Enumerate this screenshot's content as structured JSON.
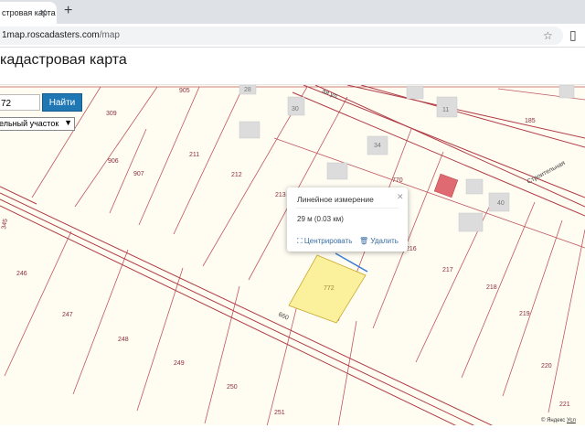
{
  "browser": {
    "tab_title": "стровая карта",
    "tab_close": "✕",
    "new_tab": "+",
    "url_host": "1map.roscadasters.com",
    "url_path": "/map",
    "star_icon": "☆",
    "side_icon": "▯"
  },
  "page": {
    "title": "кадастровая карта"
  },
  "search": {
    "input_value": "72",
    "button_label": "Найти",
    "type_selected": "ельный участок"
  },
  "popup": {
    "title": "Линейное измерение",
    "close": "✕",
    "value": "29 м (0.03 км)",
    "center_label": "Центрировать",
    "delete_label": "Удалить"
  },
  "map_labels": {
    "parcels": [
      "905",
      "28",
      "30",
      "11",
      "185",
      "309",
      "906",
      "907",
      "211",
      "212",
      "34",
      "213",
      "770",
      "40",
      "216",
      "217",
      "218",
      "219",
      "220",
      "221",
      "246",
      "247",
      "248",
      "249",
      "250",
      "251",
      "772"
    ],
    "street_top": "ая ул.",
    "street_right": "Строительная",
    "road_label": "660",
    "left_label": "345",
    "selected_parcel": "772"
  },
  "attribution": {
    "prefix": "© Яндекс",
    "terms": "Усл"
  },
  "colors": {
    "map_bg": "#fffdf2",
    "parcel_stroke": "#c0565f",
    "road_stroke": "#b03b46",
    "selected_fill": "#fbf09c",
    "building_fill": "#dcdcdc",
    "button_blue": "#1f78b4"
  }
}
